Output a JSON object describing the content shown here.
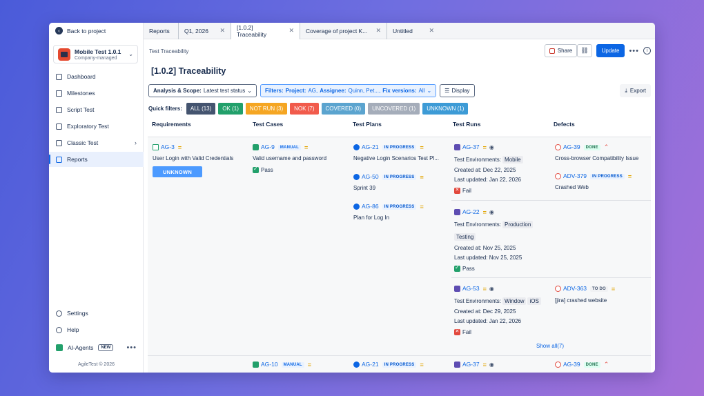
{
  "sidebar": {
    "back": "Back to project",
    "project_name": "Mobile Test 1.0.1",
    "project_type": "Company-managed",
    "nav": [
      {
        "label": "Dashboard",
        "icon": "dashboard-icon"
      },
      {
        "label": "Milestones",
        "icon": "milestone-icon"
      },
      {
        "label": "Script Test",
        "icon": "script-icon"
      },
      {
        "label": "Exploratory Test",
        "icon": "exploratory-icon"
      },
      {
        "label": "Classic Test",
        "icon": "classic-icon"
      },
      {
        "label": "Reports",
        "icon": "reports-icon"
      }
    ],
    "settings": "Settings",
    "help": "Help",
    "ai_agents": "AI-Agents",
    "ai_badge": "NEW",
    "copyright": "AgileTest © 2026"
  },
  "tabs": [
    {
      "label": "Reports"
    },
    {
      "label": "Q1, 2026"
    },
    {
      "label": "[1.0.2] Traceability"
    },
    {
      "label": "Coverage of project K..."
    },
    {
      "label": "Untitled"
    }
  ],
  "header": {
    "breadcrumb": "Test Traceability",
    "title": "[1.0.2] Traceability",
    "share": "Share",
    "update": "Update"
  },
  "filters": {
    "analysis_label": "Analysis & Scope:",
    "analysis_value": "Latest test status",
    "filters_label": "Filters:",
    "project_label": "Project:",
    "project_value": "AG,",
    "assignee_label": "Assignee:",
    "assignee_value": "Quinn, Pet...,",
    "fix_label": "Fix versions:",
    "fix_value": "All",
    "display": "Display",
    "export": "Export"
  },
  "quick_filters": {
    "label": "Quick filters:",
    "chips": [
      {
        "label": "ALL (13)",
        "color": "#44546f"
      },
      {
        "label": "OK (1)",
        "color": "#22a06b"
      },
      {
        "label": "NOT RUN (3)",
        "color": "#f5a623"
      },
      {
        "label": "NOK (7)",
        "color": "#f15b4c"
      },
      {
        "label": "COVERED (0)",
        "color": "#5ba4cf"
      },
      {
        "label": "UNCOVERED (1)",
        "color": "#a5adba"
      },
      {
        "label": "UNKNOWN (1)",
        "color": "#3d9bd6"
      }
    ]
  },
  "columns": [
    "Requirements",
    "Test Cases",
    "Test Plans",
    "Test Runs",
    "Defects"
  ],
  "rows": [
    {
      "req": {
        "key": "AG-3",
        "title": "User Login with Valid Credentials",
        "status": "UNKNOWN"
      },
      "tc": {
        "key": "AG-9",
        "badge": "MANUAL",
        "title": "Valid username and password",
        "result": "Pass"
      },
      "plans": [
        {
          "key": "AG-21",
          "badge": "IN PROGRESS",
          "title": "Negative Login Scenarios Test Pl..."
        },
        {
          "key": "AG-50",
          "badge": "IN PROGRESS",
          "title": "Sprint 39"
        },
        {
          "key": "AG-86",
          "badge": "IN PROGRESS",
          "title": "Plan for Log In"
        }
      ],
      "runs": [
        {
          "key": "AG-37",
          "env_label": "Test Environments:",
          "envs": [
            "Mobile"
          ],
          "created": "Created at: Dec 22, 2025",
          "updated": "Last updated: Jan 22, 2026",
          "result": "Fail",
          "defects": [
            {
              "key": "AG-39",
              "badge": "DONE",
              "title": "Cross-browser Compatibility Issue"
            },
            {
              "key": "ADV-379",
              "badge": "IN PROGRESS",
              "title": "Crashed Web"
            }
          ]
        },
        {
          "key": "AG-22",
          "env_label": "Test Environments:",
          "envs": [
            "Production",
            "Testing"
          ],
          "created": "Created at: Nov 25, 2025",
          "updated": "Last updated: Nov 25, 2025",
          "result": "Pass",
          "defects": []
        },
        {
          "key": "AG-53",
          "env_label": "Test Environments:",
          "envs": [
            "Window",
            "iOS"
          ],
          "created": "Created at: Dec 29, 2025",
          "updated": "Last updated: Jan 22, 2026",
          "result": "Fail",
          "defects": [
            {
              "key": "ADV-363",
              "badge": "TO DO",
              "title": "[jira] crashed website"
            }
          ]
        }
      ],
      "show_all": "Show all(7)"
    },
    {
      "tc": {
        "key": "AG-10",
        "badge": "MANUAL"
      },
      "plans": [
        {
          "key": "AG-21",
          "badge": "IN PROGRESS"
        }
      ],
      "runs": [
        {
          "key": "AG-37"
        }
      ],
      "defects": [
        {
          "key": "AG-39",
          "badge": "DONE"
        }
      ]
    }
  ]
}
